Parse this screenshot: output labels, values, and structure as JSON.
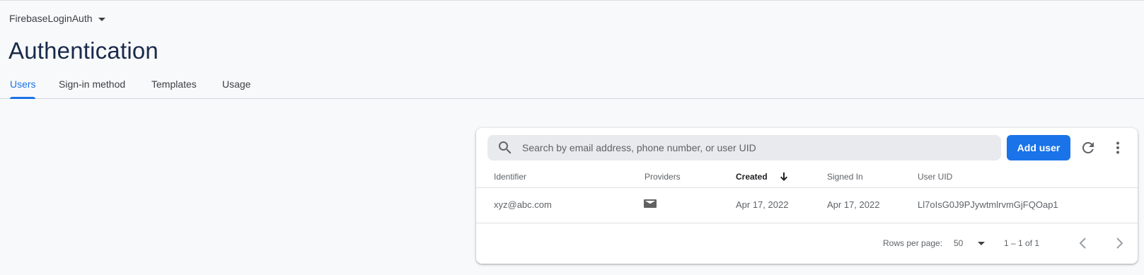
{
  "project": {
    "name": "FirebaseLoginAuth",
    "dropdown_icon": "arrow-drop-down-icon"
  },
  "page": {
    "title": "Authentication"
  },
  "tabs": [
    {
      "label": "Users",
      "active": true
    },
    {
      "label": "Sign-in method",
      "active": false
    },
    {
      "label": "Templates",
      "active": false
    },
    {
      "label": "Usage",
      "active": false
    }
  ],
  "search": {
    "placeholder": "Search by email address, phone number, or user UID",
    "value": "",
    "icon": "search-icon"
  },
  "toolbar": {
    "add_user_label": "Add user",
    "refresh_icon": "refresh-icon",
    "more_icon": "more-vertical-icon"
  },
  "table": {
    "columns": [
      "Identifier",
      "Providers",
      "Created",
      "Signed In",
      "User UID"
    ],
    "sorted_column": "Created",
    "sort_icon": "arrow-downward-icon",
    "rows": [
      {
        "identifier": "xyz@abc.com",
        "provider_icon": "email-icon",
        "created": "Apr 17, 2022",
        "signed_in": "Apr 17, 2022",
        "user_uid": "Ll7oIsG0J9PJywtmlrvmGjFQOap1"
      }
    ]
  },
  "pagination": {
    "rows_per_page_label": "Rows per page:",
    "rows_per_page_value": "50",
    "range_label": "1 – 1 of 1",
    "previous_icon": "chevron-left-icon",
    "next_icon": "chevron-right-icon"
  },
  "colors": {
    "background": "#f8f9fa",
    "primary": "#1a73e8",
    "title": "#1a2b4b",
    "text_secondary": "#5f6368",
    "search_background": "#e8eaed"
  }
}
